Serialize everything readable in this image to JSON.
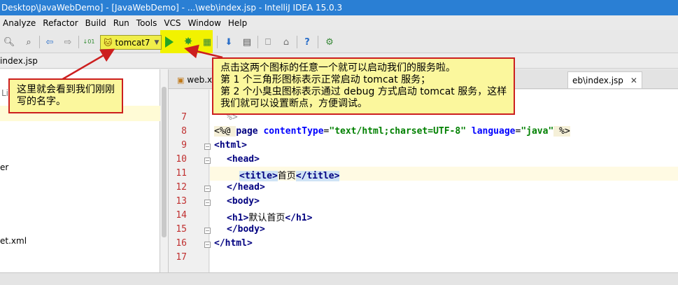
{
  "window": {
    "title": "Desktop\\JavaWebDemo] - [JavaWebDemo] - ...\\web\\index.jsp - IntelliJ IDEA 15.0.3"
  },
  "menu": [
    "Analyze",
    "Refactor",
    "Build",
    "Run",
    "Tools",
    "VCS",
    "Window",
    "Help"
  ],
  "toolbar": {
    "run_config": "tomcat7"
  },
  "navbar": {
    "crumb": "index.jsp"
  },
  "project_panel": {
    "rows": [
      {
        "text": "Lib"
      },
      {
        "text": "er"
      },
      {
        "text": "et.xml"
      }
    ]
  },
  "tabs": [
    {
      "label": "web.x",
      "active": false
    },
    {
      "label": "eb\\index.jsp",
      "active": true
    }
  ],
  "editor": {
    "line_numbers": [
      "7",
      "8",
      "9",
      "10",
      "11",
      "12",
      "13",
      "14",
      "15",
      "16",
      "17"
    ],
    "lines": {
      "l7": "%>",
      "l8_open": "<%@ ",
      "l8_kw": "page",
      "l8_a1": "contentType",
      "l8_eq1": "=",
      "l8_v1": "\"text/html;charset=UTF-8\"",
      "l8_a2": "language",
      "l8_eq2": "=",
      "l8_v2": "\"java\"",
      "l8_close": " %>",
      "l9": "<html>",
      "l10": "<head>",
      "l11_open": "<title>",
      "l11_text": "首页",
      "l11_close": "</title>",
      "l12": "</head>",
      "l13": "<body>",
      "l14_open": "<h1>",
      "l14_text": "默认首页",
      "l14_close": "</h1>",
      "l15": "</body>",
      "l16": "</html>"
    }
  },
  "callouts": {
    "left": {
      "line1": "这里就会看到我们刚刚",
      "line2": "写的名字。"
    },
    "right": {
      "line1": "点击这两个图标的任意一个就可以启动我们的服务啦。",
      "line2": "第 1 个三角形图标表示正常启动 tomcat 服务；",
      "line3": "第 2 个小臭虫图标表示通过 debug 方式启动 tomcat 服务，这样",
      "line4": "我们就可以设置断点，方便调试。"
    }
  },
  "colors": {
    "callout_bg": "#fbf79d",
    "callout_border": "#cc1f1f",
    "highlight_yellow": "#f2f200",
    "run_green": "#24a524",
    "titlebar": "#2a7fd4"
  },
  "icons": [
    "search-icon",
    "search-replace-icon",
    "back-arrow-icon",
    "forward-arrow-icon",
    "binary-icon",
    "run-icon",
    "debug-icon",
    "coverage-icon",
    "vcs-update-icon",
    "vcs-commit-icon",
    "sdk-icon",
    "android-icon",
    "help-icon",
    "android-device-icon"
  ]
}
